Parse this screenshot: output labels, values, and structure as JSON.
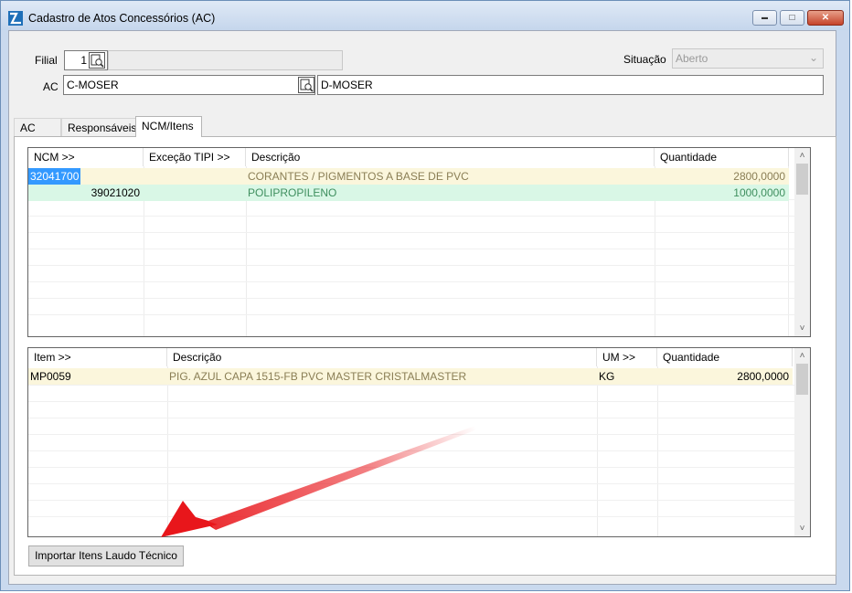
{
  "window": {
    "title": "Cadastro de Atos Concessórios (AC)",
    "minimize_symbol": "▬",
    "maximize_symbol": "□",
    "close_symbol": "✕"
  },
  "form": {
    "filial_label": "Filial",
    "filial_value": "1",
    "situacao_label": "Situação",
    "situacao_value": "Aberto",
    "ac_label": "AC",
    "ac_value": "C-MOSER",
    "ac_desc_value": "D-MOSER"
  },
  "tabs": [
    {
      "label": "AC"
    },
    {
      "label": "Responsáveis"
    },
    {
      "label": "NCM/Itens"
    }
  ],
  "ncm_grid": {
    "headers": [
      "NCM >>",
      "Exceção TIPI >>",
      "Descrição",
      "Quantidade"
    ],
    "rows": [
      {
        "ncm": "32041700",
        "excecao": "",
        "descricao": "CORANTES / PIGMENTOS A BASE DE PVC",
        "quantidade": "2800,0000"
      },
      {
        "ncm": "39021020",
        "excecao": "",
        "descricao": "POLIPROPILENO",
        "quantidade": "1000,0000"
      }
    ]
  },
  "item_grid": {
    "headers": [
      "Item >>",
      "Descrição",
      "UM >>",
      "Quantidade"
    ],
    "rows": [
      {
        "item": "MP0059",
        "descricao": "PIG. AZUL CAPA 1515-FB PVC MASTER CRISTALMASTER",
        "um": "KG",
        "quantidade": "2800,0000"
      }
    ]
  },
  "buttons": {
    "import_label": "Importar Itens Laudo Técnico"
  },
  "scroll": {
    "up": "˄",
    "down": "˅"
  },
  "colors": {
    "row_highlight_yellow": "#fbf6dc",
    "row_highlight_green": "#d9f7e6",
    "selection_blue": "#3399ff",
    "annotation_arrow": "#e8161b"
  }
}
